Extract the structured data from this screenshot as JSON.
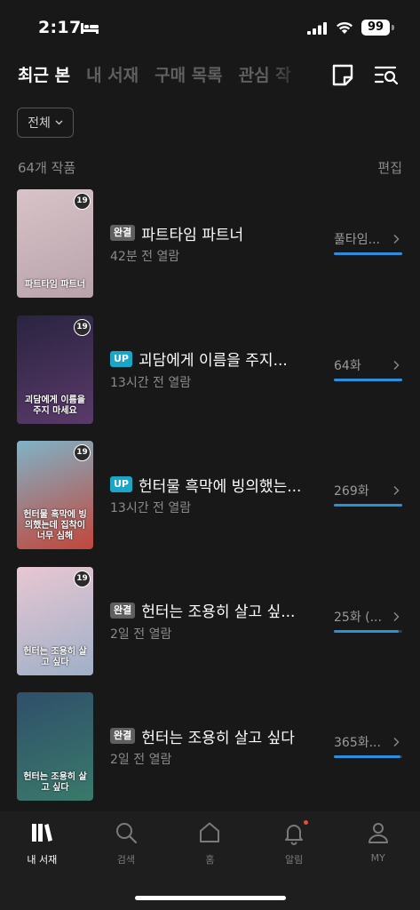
{
  "status_bar": {
    "time": "2:17",
    "battery": "99"
  },
  "tabs": [
    {
      "label": "최근 본",
      "active": true
    },
    {
      "label": "내 서재",
      "active": false
    },
    {
      "label": "구매 목록",
      "active": false
    },
    {
      "label": "관심 작",
      "active": false
    }
  ],
  "filter": {
    "label": "전체"
  },
  "count_label": "64개 작품",
  "edit_label": "편집",
  "items": [
    {
      "badge": "완결",
      "badge_type": "done",
      "title": "파트타임 파트너",
      "sub": "42분 전 열람",
      "progress_label": "풀타임...",
      "progress": 1.0,
      "age": "19",
      "cover_text": "파트타임 파트너",
      "cover_colors": [
        "#d8c3c8",
        "#b9a3ab"
      ]
    },
    {
      "badge": "UP",
      "badge_type": "up",
      "title": "괴담에게 이름을 주지...",
      "sub": "13시간 전 열람",
      "progress_label": "64화",
      "progress": 1.0,
      "age": "19",
      "cover_text": "괴담에게 이름을 주지 마세요",
      "cover_colors": [
        "#2a2440",
        "#5a3a6a"
      ]
    },
    {
      "badge": "UP",
      "badge_type": "up",
      "title": "헌터물 흑막에 빙의했는...",
      "sub": "13시간 전 열람",
      "progress_label": "269화",
      "progress": 1.0,
      "age": "19",
      "cover_text": "헌터물 흑막에 빙의했는데 집착이 너무 심해",
      "cover_colors": [
        "#7fb3c8",
        "#c2463a"
      ]
    },
    {
      "badge": "완결",
      "badge_type": "done",
      "title": "헌터는 조용히 살고 싶...",
      "sub": "2일 전 열람",
      "progress_label": "25화 (...",
      "progress": 0.95,
      "age": "19",
      "cover_text": "헌터는 조용히 살고 싶다",
      "cover_colors": [
        "#e8c7d2",
        "#9fb0c8"
      ]
    },
    {
      "badge": "완결",
      "badge_type": "done",
      "title": "헌터는 조용히 살고 싶다",
      "sub": "2일 전 열람",
      "progress_label": "365화...",
      "progress": 0.97,
      "age": "",
      "cover_text": "헌터는 조용히 살고 싶다",
      "cover_colors": [
        "#2f4f6a",
        "#3a7a6a"
      ]
    }
  ],
  "bottom_nav": [
    {
      "label": "내 서재",
      "icon": "library-icon",
      "active": true
    },
    {
      "label": "검색",
      "icon": "search-icon",
      "active": false
    },
    {
      "label": "홈",
      "icon": "home-icon",
      "active": false
    },
    {
      "label": "알림",
      "icon": "bell-icon",
      "active": false,
      "dot": true
    },
    {
      "label": "MY",
      "icon": "person-icon",
      "active": false
    }
  ],
  "colors": {
    "accent": "#2b8fdc",
    "up_badge": "#1ba6c7",
    "done_badge": "#5f5f5f",
    "background": "#181818"
  }
}
